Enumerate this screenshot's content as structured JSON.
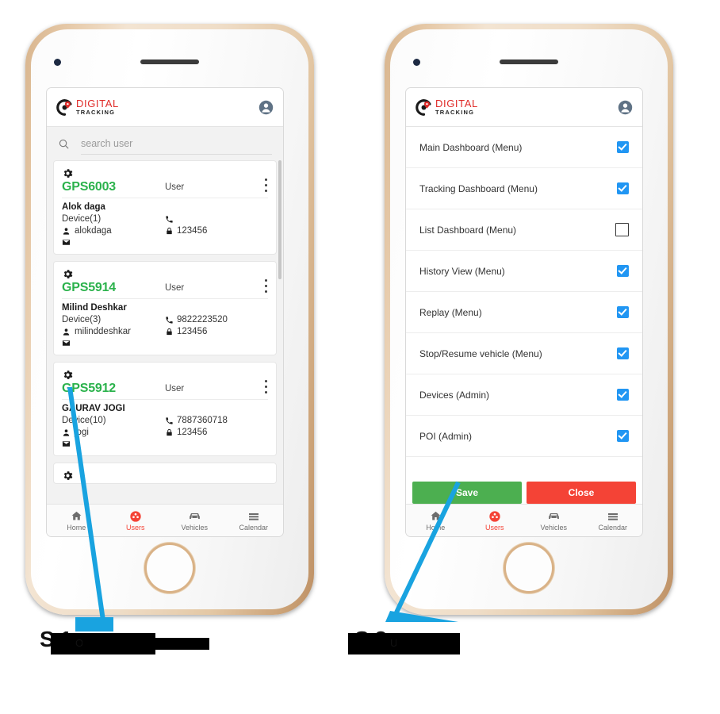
{
  "app": {
    "logo_top": "DIGITAL",
    "logo_bottom": "TRACKING",
    "logo_color": "#e02b28",
    "accent_green": "#2bb24c",
    "accent_red": "#f44336",
    "accent_blue": "#2196f3"
  },
  "screen1": {
    "search": {
      "placeholder": "search user",
      "value": ""
    },
    "users": [
      {
        "gps_id": "GPS6003",
        "role": "User",
        "name": "Alok daga",
        "device": "Device(1)",
        "phone": "",
        "username": "alokdaga",
        "password": "123456",
        "email": ""
      },
      {
        "gps_id": "GPS5914",
        "role": "User",
        "name": "Milind Deshkar",
        "device": "Device(3)",
        "phone": "9822223520",
        "username": "milinddeshkar",
        "password": "123456",
        "email": ""
      },
      {
        "gps_id": "GPS5912",
        "role": "User",
        "name": "GAURAV JOGI",
        "device": "Device(10)",
        "phone": "7887360718",
        "username": "jogi",
        "password": "123456",
        "email": ""
      }
    ]
  },
  "screen2": {
    "permissions": [
      {
        "label": "Main Dashboard  (Menu)",
        "checked": true
      },
      {
        "label": "Tracking Dashboard  (Menu)",
        "checked": true
      },
      {
        "label": "List Dashboard  (Menu)",
        "checked": false
      },
      {
        "label": "History View  (Menu)",
        "checked": true
      },
      {
        "label": "Replay  (Menu)",
        "checked": true
      },
      {
        "label": "Stop/Resume vehicle  (Menu)",
        "checked": true
      },
      {
        "label": "Devices  (Admin)",
        "checked": true
      },
      {
        "label": "POI  (Admin)",
        "checked": true
      }
    ],
    "save_label": "Save",
    "close_label": "Close"
  },
  "bottom_nav": {
    "items": [
      {
        "label": "Home",
        "icon": "home-icon",
        "active": false
      },
      {
        "label": "Users",
        "icon": "users-icon",
        "active": true
      },
      {
        "label": "Vehicles",
        "icon": "car-icon",
        "active": false
      },
      {
        "label": "Calendar",
        "icon": "calendar-icon",
        "active": false
      }
    ]
  },
  "captions": {
    "left": {
      "title": "S                 1",
      "subtitle": "O                        n"
    },
    "right": {
      "title": "S                 2",
      "subtitle": "U              s"
    }
  }
}
